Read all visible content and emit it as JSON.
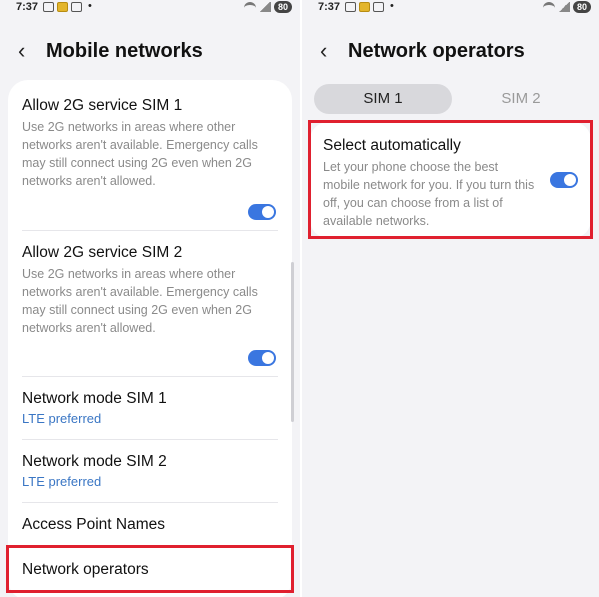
{
  "status_left": {
    "time": "7:37",
    "battery": "80"
  },
  "status_right": {
    "time": "7:37",
    "battery": "80"
  },
  "mobile_networks": {
    "title": "Mobile networks",
    "items": [
      {
        "title": "Allow 2G service SIM 1",
        "description": "Use 2G networks in areas where other networks aren't available. Emergency calls may still connect using 2G even when 2G networks aren't allowed.",
        "toggle": true
      },
      {
        "title": "Allow 2G service SIM 2",
        "description": "Use 2G networks in areas where other networks aren't available. Emergency calls may still connect using 2G even when 2G networks aren't allowed.",
        "toggle": true
      },
      {
        "title": "Network mode SIM 1",
        "subtitle": "LTE preferred"
      },
      {
        "title": "Network mode SIM 2",
        "subtitle": "LTE preferred"
      },
      {
        "title": "Access Point Names"
      },
      {
        "title": "Network operators"
      }
    ]
  },
  "network_operators": {
    "title": "Network operators",
    "tabs": [
      "SIM 1",
      "SIM 2"
    ],
    "active_tab": "SIM 1",
    "select_auto": {
      "title": "Select automatically",
      "description": "Let your phone choose the best mobile network for you. If you turn this off, you can choose from a list of available networks.",
      "toggle": true
    }
  },
  "colors": {
    "accent": "#3a76e0",
    "highlight": "#e0202f",
    "link": "#3a76c4"
  }
}
